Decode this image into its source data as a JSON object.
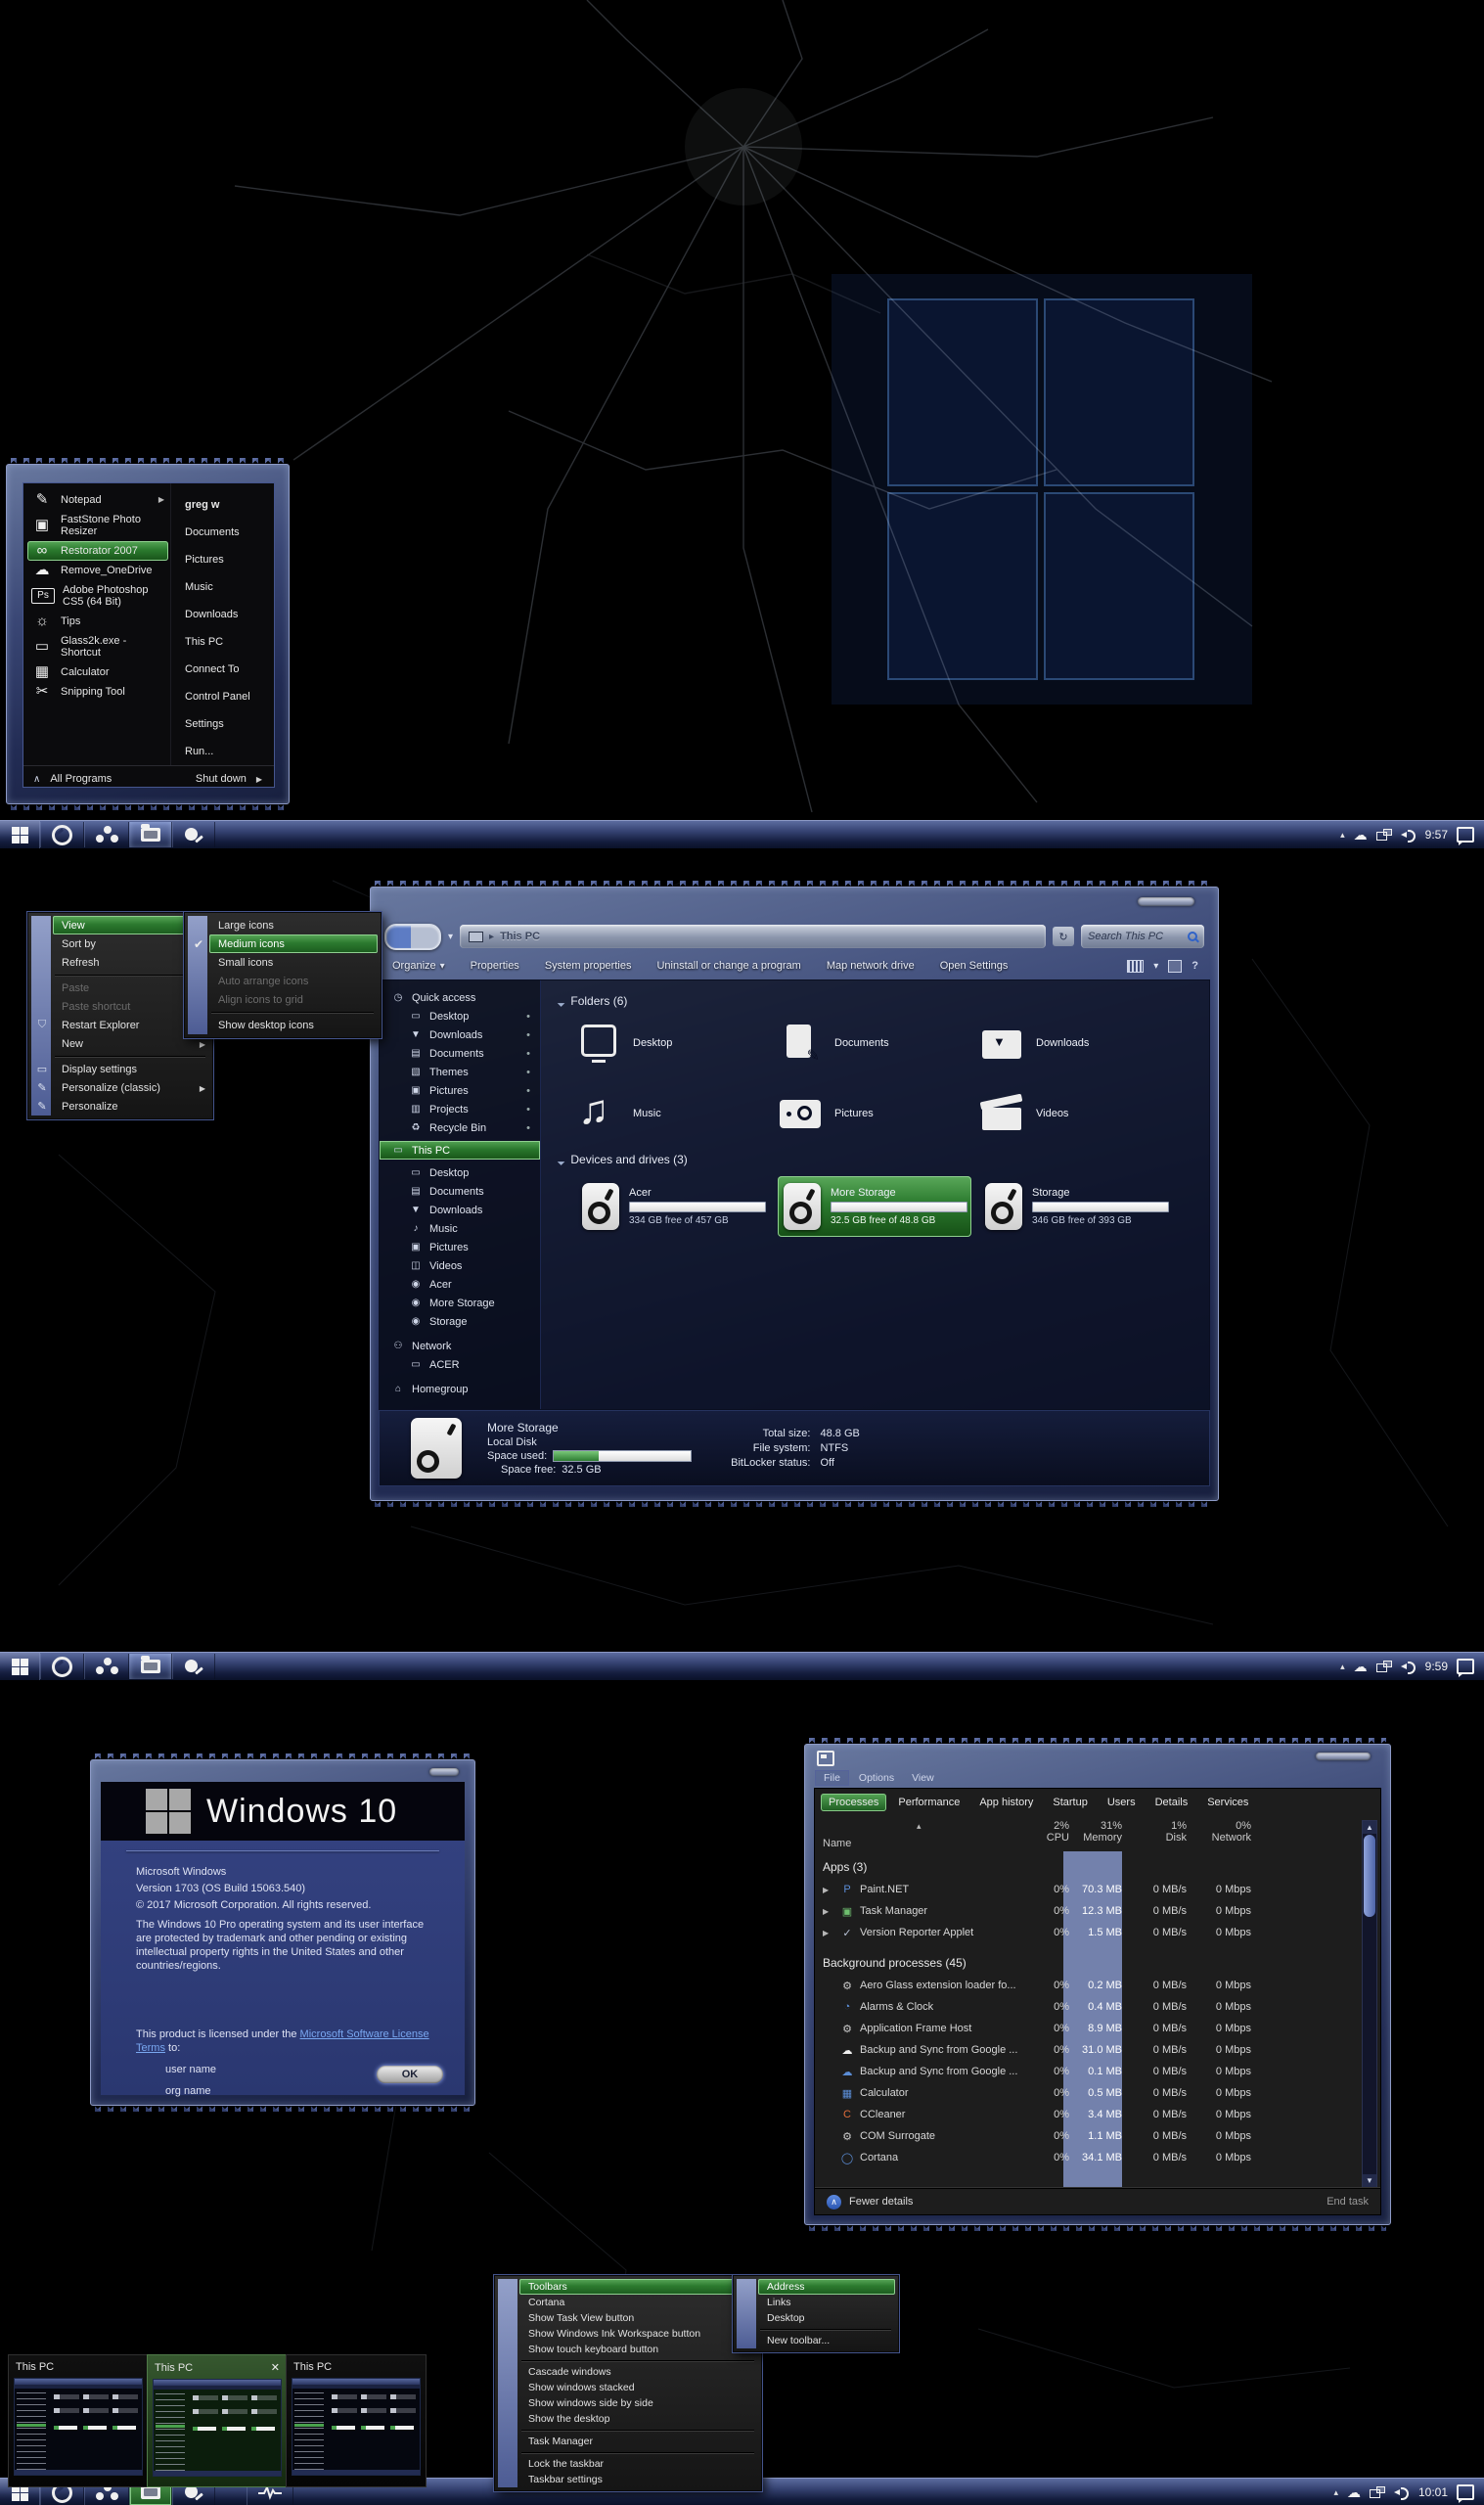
{
  "colors": {
    "accent_green": "#2f7d33",
    "frame_blue": "#4a5a8e",
    "memory_band": "#7381ac"
  },
  "start_menu": {
    "items": [
      {
        "label": "Notepad",
        "glyph": "✎"
      },
      {
        "label": "FastStone Photo Resizer",
        "glyph": "▣"
      },
      {
        "label": "Restorator 2007",
        "glyph": "∞"
      },
      {
        "label": "Remove_OneDrive",
        "glyph": "☁"
      },
      {
        "label": "Adobe Photoshop CS5 (64 Bit)",
        "glyph": "Ps"
      },
      {
        "label": "Tips",
        "glyph": "☼"
      },
      {
        "label": "Glass2k.exe - Shortcut",
        "glyph": "▭"
      },
      {
        "label": "Calculator",
        "glyph": "▦"
      },
      {
        "label": "Snipping Tool",
        "glyph": "✂"
      }
    ],
    "all_programs": "All Programs",
    "user": "greg w",
    "right_items": [
      {
        "label": "Documents"
      },
      {
        "label": "Pictures"
      },
      {
        "label": "Music"
      },
      {
        "label": "Downloads"
      },
      {
        "label": "This PC"
      },
      {
        "label": "Connect To"
      },
      {
        "label": "Control Panel"
      },
      {
        "label": "Settings"
      },
      {
        "label": "Run..."
      }
    ],
    "shut_down": "Shut down"
  },
  "taskbar1": {
    "time": "9:57"
  },
  "taskbar2": {
    "time": "9:59"
  },
  "taskbar3": {
    "time": "10:01"
  },
  "desktop_menu": {
    "items": [
      {
        "label": "View"
      },
      {
        "label": "Sort by"
      },
      {
        "label": "Refresh"
      },
      {
        "label": "Paste"
      },
      {
        "label": "Paste shortcut"
      },
      {
        "label": "Restart Explorer"
      },
      {
        "label": "New"
      },
      {
        "label": "Display settings"
      },
      {
        "label": "Personalize (classic)"
      },
      {
        "label": "Personalize"
      }
    ]
  },
  "view_menu": {
    "items": [
      {
        "label": "Large icons"
      },
      {
        "label": "Medium icons"
      },
      {
        "label": "Small icons"
      },
      {
        "label": "Auto arrange icons"
      },
      {
        "label": "Align icons to grid"
      },
      {
        "label": "Show desktop icons"
      }
    ]
  },
  "explorer": {
    "address": "This PC",
    "search": "Search This PC",
    "toolbar": {
      "organize": "Organize",
      "properties": "Properties",
      "system_properties": "System properties",
      "uninstall": "Uninstall or change a program",
      "map_drive": "Map network drive",
      "open_settings": "Open Settings",
      "help": "?"
    },
    "sidebar": {
      "quick_access": "Quick access",
      "quick_items": [
        {
          "label": "Desktop",
          "glyph": "▭"
        },
        {
          "label": "Downloads",
          "glyph": "▼"
        },
        {
          "label": "Documents",
          "glyph": "▤"
        },
        {
          "label": "Themes",
          "glyph": "▧"
        },
        {
          "label": "Pictures",
          "glyph": "▣"
        },
        {
          "label": "Projects",
          "glyph": "▥"
        },
        {
          "label": "Recycle Bin",
          "glyph": "♻"
        }
      ],
      "this_pc": "This PC",
      "pc_items": [
        {
          "label": "Desktop",
          "glyph": "▭"
        },
        {
          "label": "Documents",
          "glyph": "▤"
        },
        {
          "label": "Downloads",
          "glyph": "▼"
        },
        {
          "label": "Music",
          "glyph": "♪"
        },
        {
          "label": "Pictures",
          "glyph": "▣"
        },
        {
          "label": "Videos",
          "glyph": "◫"
        },
        {
          "label": "Acer",
          "glyph": "◉"
        },
        {
          "label": "More Storage",
          "glyph": "◉"
        },
        {
          "label": "Storage",
          "glyph": "◉"
        }
      ],
      "network": "Network",
      "network_items": [
        {
          "label": "ACER",
          "glyph": "▭"
        }
      ],
      "homegroup": "Homegroup"
    },
    "folders_header": "Folders (6)",
    "folders": [
      {
        "label": "Desktop"
      },
      {
        "label": "Documents"
      },
      {
        "label": "Downloads"
      },
      {
        "label": "Music"
      },
      {
        "label": "Pictures"
      },
      {
        "label": "Videos"
      }
    ],
    "drives_header": "Devices and drives (3)",
    "drives": [
      {
        "name": "Acer",
        "free": "334 GB free of 457 GB",
        "used_pct": "27"
      },
      {
        "name": "More Storage",
        "free": "32.5 GB free of 48.8 GB",
        "used_pct": "33"
      },
      {
        "name": "Storage",
        "free": "346 GB free of 393 GB",
        "used_pct": "12"
      }
    ],
    "status": {
      "name": "More Storage",
      "type": "Local Disk",
      "space_used_label": "Space used:",
      "space_free_label": "Space free:",
      "space_free_value": "32.5 GB",
      "total_label": "Total size:",
      "total_value": "48.8 GB",
      "fs_label": "File system:",
      "fs_value": "NTFS",
      "bl_label": "BitLocker status:",
      "bl_value": "Off",
      "used_pct": "33"
    }
  },
  "winver": {
    "brand": "Windows 10",
    "l1": "Microsoft Windows",
    "l2": "Version 1703 (OS Build 15063.540)",
    "l3": "© 2017 Microsoft Corporation.  All rights reserved.",
    "l4": "The Windows 10 Pro operating system and its user interface are protected by trademark and other pending or existing intellectual property rights in the United States and other countries/regions.",
    "l5a": "This product is licensed under the",
    "l5link": "Microsoft Software License Terms",
    "l5b": "to:",
    "user": "user name",
    "org": "org name",
    "ok": "OK"
  },
  "task_manager": {
    "menu": [
      {
        "label": "File"
      },
      {
        "label": "Options"
      },
      {
        "label": "View"
      }
    ],
    "tabs": [
      {
        "label": "Processes"
      },
      {
        "label": "Performance"
      },
      {
        "label": "App history"
      },
      {
        "label": "Startup"
      },
      {
        "label": "Users"
      },
      {
        "label": "Details"
      },
      {
        "label": "Services"
      }
    ],
    "name_col": "Name",
    "cols": [
      {
        "pct": "2%",
        "label": "CPU"
      },
      {
        "pct": "31%",
        "label": "Memory"
      },
      {
        "pct": "1%",
        "label": "Disk"
      },
      {
        "pct": "0%",
        "label": "Network"
      }
    ],
    "apps_header": "Apps (3)",
    "apps": [
      {
        "name": "Paint.NET",
        "cpu": "0%",
        "mem": "70.3 MB",
        "disk": "0 MB/s",
        "net": "0 Mbps",
        "glyph": "P",
        "gcolor": "#5b8dd6"
      },
      {
        "name": "Task Manager",
        "cpu": "0%",
        "mem": "12.3 MB",
        "disk": "0 MB/s",
        "net": "0 Mbps",
        "glyph": "▣",
        "gcolor": "#6fbf6f"
      },
      {
        "name": "Version Reporter Applet",
        "cpu": "0%",
        "mem": "1.5 MB",
        "disk": "0 MB/s",
        "net": "0 Mbps",
        "glyph": "✓",
        "gcolor": "#b9c2d6"
      }
    ],
    "bg_header": "Background processes (45)",
    "bg": [
      {
        "name": "Aero Glass extension loader fo...",
        "cpu": "0%",
        "mem": "0.2 MB",
        "disk": "0 MB/s",
        "net": "0 Mbps",
        "glyph": "⚙",
        "gcolor": "#c9c9c9"
      },
      {
        "name": "Alarms & Clock",
        "cpu": "0%",
        "mem": "0.4 MB",
        "disk": "0 MB/s",
        "net": "0 Mbps",
        "glyph": "◔",
        "gcolor": "#5b8dd6"
      },
      {
        "name": "Application Frame Host",
        "cpu": "0%",
        "mem": "8.9 MB",
        "disk": "0 MB/s",
        "net": "0 Mbps",
        "glyph": "⚙",
        "gcolor": "#c9c9c9"
      },
      {
        "name": "Backup and Sync from Google ...",
        "cpu": "0%",
        "mem": "31.0 MB",
        "disk": "0 MB/s",
        "net": "0 Mbps",
        "glyph": "☁",
        "gcolor": "#f0f0f0"
      },
      {
        "name": "Backup and Sync from Google ...",
        "cpu": "0%",
        "mem": "0.1 MB",
        "disk": "0 MB/s",
        "net": "0 Mbps",
        "glyph": "☁",
        "gcolor": "#5b8dd6"
      },
      {
        "name": "Calculator",
        "cpu": "0%",
        "mem": "0.5 MB",
        "disk": "0 MB/s",
        "net": "0 Mbps",
        "glyph": "▦",
        "gcolor": "#5b8dd6"
      },
      {
        "name": "CCleaner",
        "cpu": "0%",
        "mem": "3.4 MB",
        "disk": "0 MB/s",
        "net": "0 Mbps",
        "glyph": "C",
        "gcolor": "#e06c3a"
      },
      {
        "name": "COM Surrogate",
        "cpu": "0%",
        "mem": "1.1 MB",
        "disk": "0 MB/s",
        "net": "0 Mbps",
        "glyph": "⚙",
        "gcolor": "#c9c9c9"
      },
      {
        "name": "Cortana",
        "cpu": "0%",
        "mem": "34.1 MB",
        "disk": "0 MB/s",
        "net": "0 Mbps",
        "glyph": "◯",
        "gcolor": "#5b8dd6"
      }
    ],
    "footer": {
      "fewer": "Fewer details",
      "end_task": "End task"
    }
  },
  "taskbar_menu": {
    "items": [
      {
        "label": "Toolbars"
      },
      {
        "label": "Cortana"
      },
      {
        "label": "Show Task View button"
      },
      {
        "label": "Show Windows Ink Workspace button"
      },
      {
        "label": "Show touch keyboard button"
      },
      {
        "label": "Cascade windows"
      },
      {
        "label": "Show windows stacked"
      },
      {
        "label": "Show windows side by side"
      },
      {
        "label": "Show the desktop"
      },
      {
        "label": "Task Manager"
      },
      {
        "label": "Lock the taskbar"
      },
      {
        "label": "Taskbar settings"
      }
    ]
  },
  "toolbars_menu": {
    "items": [
      {
        "label": "Address"
      },
      {
        "label": "Links"
      },
      {
        "label": "Desktop"
      },
      {
        "label": "New toolbar..."
      }
    ]
  },
  "thumbnails": [
    {
      "label": "This PC"
    },
    {
      "label": "This PC"
    },
    {
      "label": "This PC"
    }
  ]
}
